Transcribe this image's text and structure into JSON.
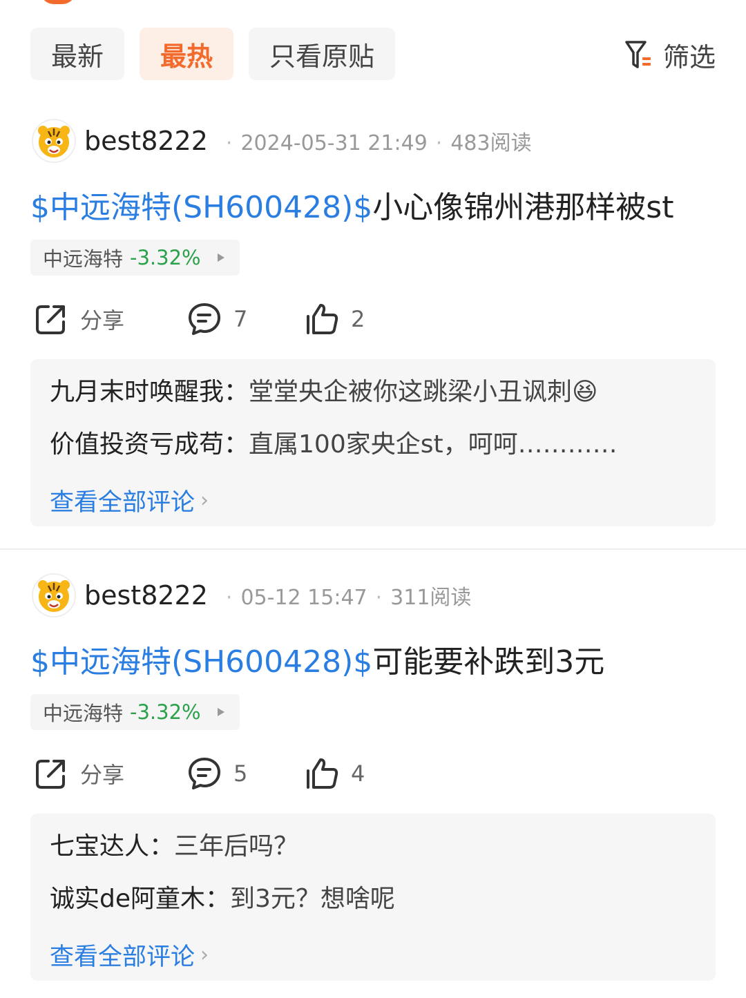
{
  "tabs": [
    {
      "label": "最新",
      "active": false
    },
    {
      "label": "最热",
      "active": true
    },
    {
      "label": "只看原贴",
      "active": false
    }
  ],
  "filter": {
    "label": "筛选",
    "icon": "filter-icon"
  },
  "posts": [
    {
      "author": "best8222",
      "time": "2024-05-31 21:49",
      "reads": "483阅读",
      "stock_tag": "$中远海特(SH600428)$",
      "text": "小心像锦州港那样被st",
      "chip_name": "中远海特",
      "chip_change": "-3.32%",
      "share_label": "分享",
      "comment_count": "7",
      "like_count": "2",
      "comments": [
        {
          "name": "九月末时唤醒我：",
          "text": "堂堂央企被你这跳梁小丑讽刺😆"
        },
        {
          "name": "价值投资亏成苟：",
          "text": "直属100家央企st，呵呵…………"
        }
      ],
      "more_label": "查看全部评论"
    },
    {
      "author": "best8222",
      "time": "05-12 15:47",
      "reads": "311阅读",
      "stock_tag": "$中远海特(SH600428)$",
      "text": "可能要补跌到3元",
      "chip_name": "中远海特",
      "chip_change": "-3.32%",
      "share_label": "分享",
      "comment_count": "5",
      "like_count": "4",
      "comments": [
        {
          "name": "七宝达人：",
          "text": "三年后吗？"
        },
        {
          "name": "诚实de阿童木：",
          "text": "到3元？想啥呢"
        }
      ],
      "more_label": "查看全部评论"
    }
  ],
  "colors": {
    "accent": "#f26a2c",
    "link": "#2a7de1",
    "down": "#2aa14a"
  }
}
